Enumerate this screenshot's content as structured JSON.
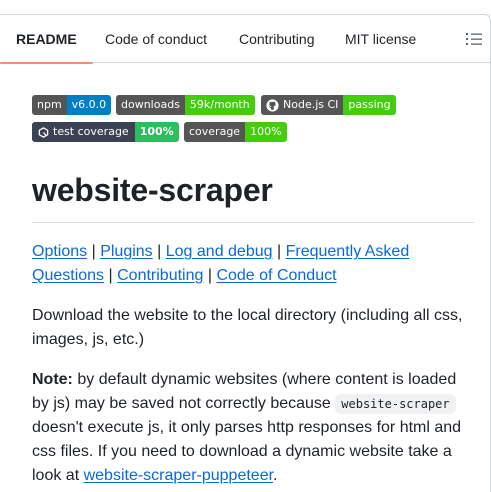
{
  "tabs": [
    {
      "label": "README",
      "active": true
    },
    {
      "label": "Code of conduct",
      "active": false
    },
    {
      "label": "Contributing",
      "active": false
    },
    {
      "label": "MIT license",
      "active": false
    }
  ],
  "outline_icon": "list-unordered-icon",
  "badges": {
    "npm": {
      "label": "npm",
      "value": "v6.0.0",
      "color": "#007ec6"
    },
    "downloads": {
      "label": "downloads",
      "value": "59k/month",
      "color": "#4c1"
    },
    "ci": {
      "label": "Node.js CI",
      "value": "passing",
      "color": "#4c1",
      "icon": "github-icon"
    },
    "test_coverage": {
      "label": "test coverage",
      "value": "100%",
      "color": "#2fbc5c",
      "icon": "qlty-icon"
    },
    "coverage": {
      "label": "coverage",
      "value": "100%",
      "color": "#4c1"
    }
  },
  "title": "website-scraper",
  "links": [
    "Options",
    "Plugins",
    "Log and debug",
    "Frequently Asked Questions",
    "Contributing",
    "Code of Conduct"
  ],
  "link_separator": "|",
  "description": "Download the website to the local directory (including all css, images, js, etc.)",
  "note": {
    "label": "Note:",
    "text1": "by default dynamic websites (where content is loaded by js) may be saved not correctly because",
    "code": "website-scraper",
    "text2": "doesn't execute js, it only parses http responses for html and css files. If you need to download a dynamic website take a look at",
    "link": "website-scraper-puppeteer",
    "end": "."
  }
}
